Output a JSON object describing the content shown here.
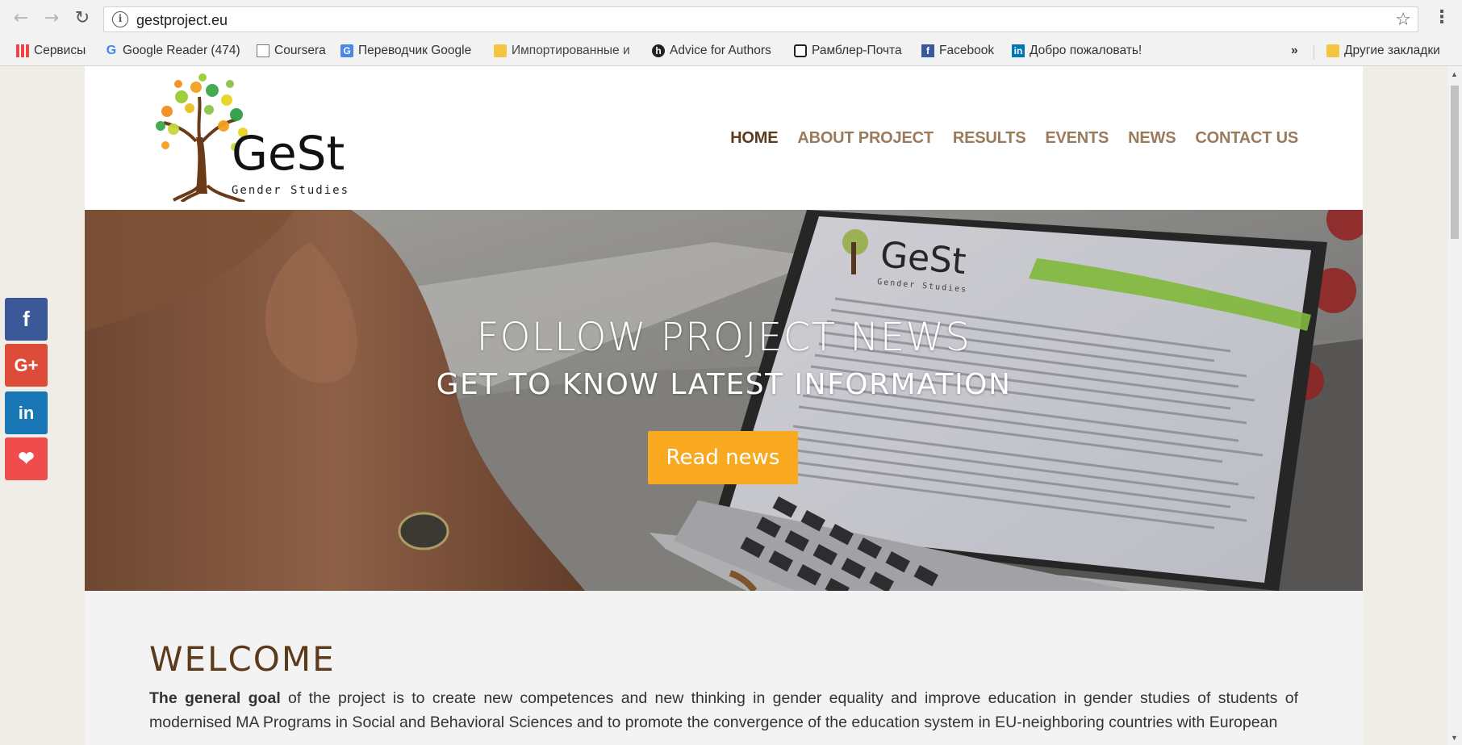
{
  "browser": {
    "url": "gestproject.eu",
    "bookmarks": [
      {
        "label": "Сервисы",
        "icon": "apps-icon"
      },
      {
        "label": "Google Reader (474)",
        "icon": "google-icon"
      },
      {
        "label": "Coursera",
        "icon": "page-icon"
      },
      {
        "label": "Переводчик Google",
        "icon": "google-translate-icon"
      },
      {
        "label": "Импортированные и",
        "icon": "folder-icon"
      },
      {
        "label": "Advice for Authors",
        "icon": "site-icon"
      },
      {
        "label": "Рамблер-Почта",
        "icon": "mail-icon"
      },
      {
        "label": "Facebook",
        "icon": "facebook-icon"
      },
      {
        "label": "Добро пожаловать!",
        "icon": "linkedin-icon"
      }
    ],
    "overflow_label": "»",
    "other_bookmarks": "Другие закладки"
  },
  "site": {
    "logo_text": "GeSt",
    "logo_subtitle": "Gender Studies",
    "nav": [
      "HOME",
      "ABOUT PROJECT",
      "RESULTS",
      "EVENTS",
      "NEWS",
      "CONTACT US"
    ],
    "active_nav": "HOME"
  },
  "hero": {
    "title": "FOLLOW PROJECT NEWS",
    "subtitle": "GET TO KNOW LATEST INFORMATION",
    "button": "Read news",
    "screen_logo": "GeSt",
    "screen_logo_sub": "Gender Studies"
  },
  "welcome": {
    "heading": "WELCOME",
    "intro_bold": "The general goal",
    "intro_text": " of the project is to create new competences and new thinking in gender equality and improve education in gender studies of students of modernised MA Programs in Social and Behavioral Sciences and to promote the convergence of the education system in EU-neighboring countries with European"
  },
  "share": {
    "facebook": "f",
    "googleplus": "G+",
    "linkedin": "in",
    "favorite": "❤"
  },
  "colors": {
    "nav_active": "#5c3a1c",
    "nav_link": "#9b7a5b",
    "button": "#f9a920",
    "heading": "#5c3a1c"
  }
}
